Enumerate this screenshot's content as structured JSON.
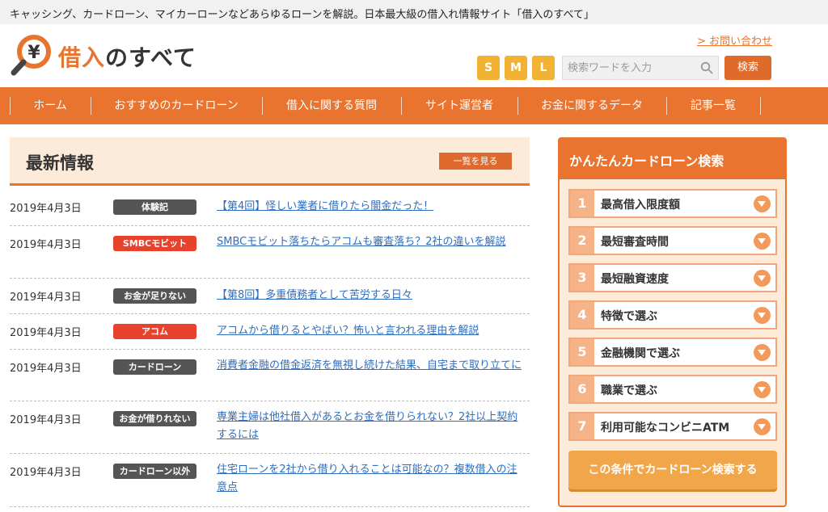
{
  "topbar": {
    "tagline": "キャッシング、カードローン、マイカーローンなどあらゆるローンを解説。日本最大級の借入れ情報サイト「借入のすべて」"
  },
  "logo": {
    "mark": "¥",
    "accent": "借入",
    "rest": "のすべて"
  },
  "header": {
    "contact": "> お問い合わせ",
    "sizes": [
      "S",
      "M",
      "L"
    ],
    "search_placeholder": "検索ワードを入力",
    "search_button": "検索"
  },
  "nav": {
    "items": [
      "ホーム",
      "おすすめのカードローン",
      "借入に関する質問",
      "サイト運営者",
      "お金に関するデータ",
      "記事一覧"
    ]
  },
  "news": {
    "title": "最新情報",
    "see_all": "一覧を見る",
    "items": [
      {
        "date": "2019年4月3日",
        "tag": "体験記",
        "tag_color": "#555555",
        "title": "【第4回】怪しい業者に借りたら闇金だった！"
      },
      {
        "date": "2019年4月3日",
        "tag": "SMBCモビット",
        "tag_color": "#e8412c",
        "title": "SMBCモビット落ちたらアコムも審査落ち？2社の違いを解説"
      },
      {
        "date": "2019年4月3日",
        "tag": "お金が足りない",
        "tag_color": "#555555",
        "title": "【第8回】多重債務者として苦労する日々"
      },
      {
        "date": "2019年4月3日",
        "tag": "アコム",
        "tag_color": "#e8412c",
        "title": "アコムから借りるとやばい？怖いと言われる理由を解説"
      },
      {
        "date": "2019年4月3日",
        "tag": "カードローン",
        "tag_color": "#555555",
        "title": "消費者金融の借金返済を無視し続けた結果、自宅まで取り立てに"
      },
      {
        "date": "2019年4月3日",
        "tag": "お金が借りれない",
        "tag_color": "#555555",
        "title": "専業主婦は他社借入があるとお金を借りられない？2社以上契約するには"
      },
      {
        "date": "2019年4月3日",
        "tag": "カードローン以外",
        "tag_color": "#555555",
        "title": "住宅ローンを2社から借り入れることは可能なの？複数借入の注意点"
      }
    ]
  },
  "search_panel": {
    "title": "かんたんカードローン検索",
    "items": [
      {
        "num": "1",
        "label": "最高借入限度額"
      },
      {
        "num": "2",
        "label": "最短審査時間"
      },
      {
        "num": "3",
        "label": "最短融資速度"
      },
      {
        "num": "4",
        "label": "特徴で選ぶ"
      },
      {
        "num": "5",
        "label": "金融機関で選ぶ"
      },
      {
        "num": "6",
        "label": "職業で選ぶ"
      },
      {
        "num": "7",
        "label": "利用可能なコンビニATM"
      }
    ],
    "button": "この条件でカードローン検索する"
  },
  "colors": {
    "accent": "#e8742f",
    "link": "#2f6dbd",
    "tag_red": "#e8412c",
    "tag_gray": "#555555",
    "panel_bg": "#fdebd9",
    "size_btn": "#f2b233"
  }
}
